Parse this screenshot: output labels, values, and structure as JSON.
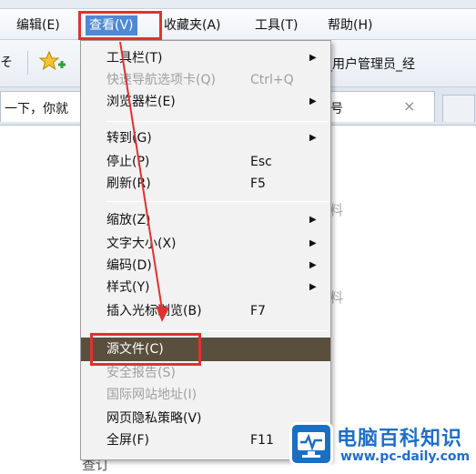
{
  "menubar": {
    "items": [
      "编辑(E)",
      "查看(V)",
      "收藏夹(A)",
      "工具(T)",
      "帮助(H)"
    ]
  },
  "favorites_bar": {
    "left_fragment": "そ",
    "tab_title_fragment": "_用户管理员_经"
  },
  "tabs": {
    "left_tab_text": "一下，你就",
    "right_tab_fragment": "号",
    "close_glyph": "×"
  },
  "background_fragments": [
    "料",
    "料",
    "查订"
  ],
  "view_menu": {
    "items": [
      {
        "label": "工具栏(T)",
        "shortcut": "",
        "submenu": true,
        "disabled": false
      },
      {
        "label": "快速导航选项卡(Q)",
        "shortcut": "Ctrl+Q",
        "submenu": false,
        "disabled": true
      },
      {
        "label": "浏览器栏(E)",
        "shortcut": "",
        "submenu": true,
        "disabled": false
      },
      {
        "label": "转到(G)",
        "shortcut": "",
        "submenu": true,
        "disabled": false
      },
      {
        "label": "停止(P)",
        "shortcut": "Esc",
        "submenu": false,
        "disabled": false
      },
      {
        "label": "刷新(R)",
        "shortcut": "F5",
        "submenu": false,
        "disabled": false
      },
      {
        "label": "缩放(Z)",
        "shortcut": "",
        "submenu": true,
        "disabled": false
      },
      {
        "label": "文字大小(X)",
        "shortcut": "",
        "submenu": true,
        "disabled": false
      },
      {
        "label": "编码(D)",
        "shortcut": "",
        "submenu": true,
        "disabled": false
      },
      {
        "label": "样式(Y)",
        "shortcut": "",
        "submenu": true,
        "disabled": false
      },
      {
        "label": "插入光标浏览(B)",
        "shortcut": "F7",
        "submenu": false,
        "disabled": false
      },
      {
        "label": "源文件(C)",
        "shortcut": "",
        "submenu": false,
        "disabled": false,
        "selected": true
      },
      {
        "label": "安全报告(S)",
        "shortcut": "",
        "submenu": false,
        "disabled": true
      },
      {
        "label": "国际网站地址(I)",
        "shortcut": "",
        "submenu": false,
        "disabled": true
      },
      {
        "label": "网页隐私策略(V)",
        "shortcut": "",
        "submenu": false,
        "disabled": false
      },
      {
        "label": "全屏(F)",
        "shortcut": "F11",
        "submenu": false,
        "disabled": false
      }
    ],
    "submenu_glyph": "▶"
  },
  "watermark": {
    "title": "电脑百科知识",
    "url": "www.pc-daily.com"
  },
  "colors": {
    "highlight_box": "#e0322f",
    "selected_item_bg": "#5a4f3d",
    "watermark_blue": "#1e6fcb"
  }
}
